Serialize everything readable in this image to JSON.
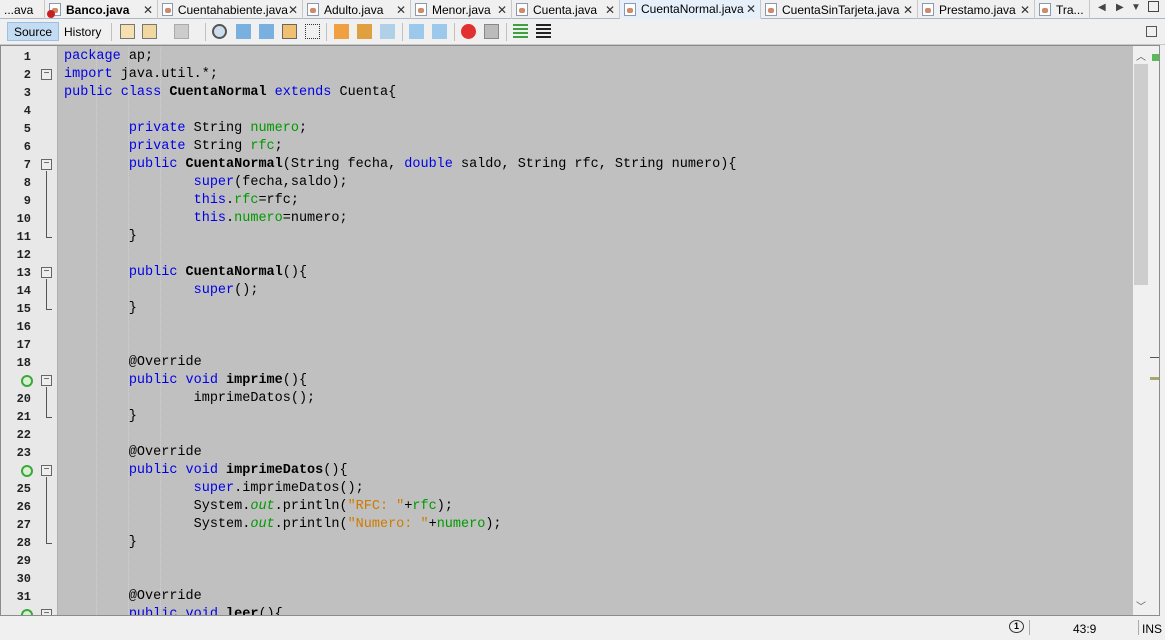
{
  "tabs": [
    {
      "label": "...ava",
      "active": false,
      "error": false,
      "closable": false
    },
    {
      "label": "Banco.java",
      "active": false,
      "error": true,
      "bold": true,
      "closable": true
    },
    {
      "label": "Cuentahabiente.java",
      "active": false,
      "error": false,
      "closable": true
    },
    {
      "label": "Adulto.java",
      "active": false,
      "error": false,
      "closable": true
    },
    {
      "label": "Menor.java",
      "active": false,
      "error": false,
      "closable": true
    },
    {
      "label": "Cuenta.java",
      "active": false,
      "error": false,
      "closable": true
    },
    {
      "label": "CuentaNormal.java",
      "active": true,
      "error": false,
      "closable": true
    },
    {
      "label": "CuentaSinTarjeta.java",
      "active": false,
      "error": false,
      "closable": true
    },
    {
      "label": "Prestamo.java",
      "active": false,
      "error": false,
      "closable": true
    },
    {
      "label": "Tra...",
      "active": false,
      "error": false,
      "closable": false
    }
  ],
  "tab_close": "✕",
  "toolbar": {
    "source": "Source",
    "history": "History"
  },
  "editor": {
    "line_numbers": [
      "1",
      "2",
      "3",
      "4",
      "5",
      "6",
      "7",
      "8",
      "9",
      "10",
      "11",
      "12",
      "13",
      "14",
      "15",
      "16",
      "17",
      "18",
      "",
      "20",
      "21",
      "22",
      "23",
      "",
      "25",
      "26",
      "27",
      "28",
      "29",
      "30",
      "31",
      ""
    ],
    "override_markers": [
      19,
      24,
      32
    ],
    "fold_markers": [
      2,
      7,
      13,
      19,
      24,
      32
    ],
    "lines": [
      [
        [
          "package",
          "k"
        ],
        [
          " ap;",
          ""
        ]
      ],
      [
        [
          "import",
          "k"
        ],
        [
          " java.util.*;",
          ""
        ]
      ],
      [
        [
          "public",
          "k"
        ],
        [
          " ",
          ""
        ],
        [
          "class",
          "k"
        ],
        [
          " ",
          ""
        ],
        [
          "CuentaNormal",
          "m"
        ],
        [
          " ",
          ""
        ],
        [
          "extends",
          "k"
        ],
        [
          " Cuenta{",
          ""
        ]
      ],
      [],
      [
        [
          "        ",
          ""
        ],
        [
          "private",
          "k"
        ],
        [
          " String ",
          ""
        ],
        [
          "numero",
          "f"
        ],
        [
          ";",
          ""
        ]
      ],
      [
        [
          "        ",
          ""
        ],
        [
          "private",
          "k"
        ],
        [
          " String ",
          ""
        ],
        [
          "rfc",
          "f"
        ],
        [
          ";",
          ""
        ]
      ],
      [
        [
          "        ",
          ""
        ],
        [
          "public",
          "k"
        ],
        [
          " ",
          ""
        ],
        [
          "CuentaNormal",
          "m"
        ],
        [
          "(String fecha, ",
          ""
        ],
        [
          "double",
          "k"
        ],
        [
          " saldo, String rfc, String numero){",
          ""
        ]
      ],
      [
        [
          "                ",
          ""
        ],
        [
          "super",
          "k"
        ],
        [
          "(fecha,saldo);",
          ""
        ]
      ],
      [
        [
          "                ",
          ""
        ],
        [
          "this",
          "k"
        ],
        [
          ".",
          ""
        ],
        [
          "rfc",
          "f"
        ],
        [
          "=rfc;",
          ""
        ]
      ],
      [
        [
          "                ",
          ""
        ],
        [
          "this",
          "k"
        ],
        [
          ".",
          ""
        ],
        [
          "numero",
          "f"
        ],
        [
          "=numero;",
          ""
        ]
      ],
      [
        [
          "        }",
          ""
        ]
      ],
      [],
      [
        [
          "        ",
          ""
        ],
        [
          "public",
          "k"
        ],
        [
          " ",
          ""
        ],
        [
          "CuentaNormal",
          "m"
        ],
        [
          "(){",
          ""
        ]
      ],
      [
        [
          "                ",
          ""
        ],
        [
          "super",
          "k"
        ],
        [
          "();",
          ""
        ]
      ],
      [
        [
          "        }",
          ""
        ]
      ],
      [],
      [],
      [
        [
          "        @Override",
          ""
        ]
      ],
      [
        [
          "        ",
          ""
        ],
        [
          "public",
          "k"
        ],
        [
          " ",
          ""
        ],
        [
          "void",
          "k"
        ],
        [
          " ",
          ""
        ],
        [
          "imprime",
          "m"
        ],
        [
          "(){",
          ""
        ]
      ],
      [
        [
          "                imprimeDatos();",
          ""
        ]
      ],
      [
        [
          "        }",
          ""
        ]
      ],
      [],
      [
        [
          "        @Override",
          ""
        ]
      ],
      [
        [
          "        ",
          ""
        ],
        [
          "public",
          "k"
        ],
        [
          " ",
          ""
        ],
        [
          "void",
          "k"
        ],
        [
          " ",
          ""
        ],
        [
          "imprimeDatos",
          "m"
        ],
        [
          "(){",
          ""
        ]
      ],
      [
        [
          "                ",
          ""
        ],
        [
          "super",
          "k"
        ],
        [
          ".imprimeDatos();",
          ""
        ]
      ],
      [
        [
          "                System.",
          ""
        ],
        [
          "out",
          "i"
        ],
        [
          ".println(",
          ""
        ],
        [
          "\"RFC: \"",
          "s"
        ],
        [
          "+",
          ""
        ],
        [
          "rfc",
          "f"
        ],
        [
          ");",
          ""
        ]
      ],
      [
        [
          "                System.",
          ""
        ],
        [
          "out",
          "i"
        ],
        [
          ".println(",
          ""
        ],
        [
          "\"Numero: \"",
          "s"
        ],
        [
          "+",
          ""
        ],
        [
          "numero",
          "f"
        ],
        [
          ");",
          ""
        ]
      ],
      [
        [
          "        }",
          ""
        ]
      ],
      [],
      [],
      [
        [
          "        @Override",
          ""
        ]
      ],
      [
        [
          "        ",
          ""
        ],
        [
          "public",
          "k"
        ],
        [
          " ",
          ""
        ],
        [
          "void",
          "k"
        ],
        [
          " ",
          ""
        ],
        [
          "leer",
          "m"
        ],
        [
          "(){",
          ""
        ]
      ]
    ]
  },
  "status": {
    "notifications": "1",
    "position": "43:9",
    "mode": "INS"
  },
  "colors": {
    "keyword": "#0000e6",
    "field": "#009900",
    "string": "#ce7b00",
    "editor_bg": "#c0c0c0"
  }
}
